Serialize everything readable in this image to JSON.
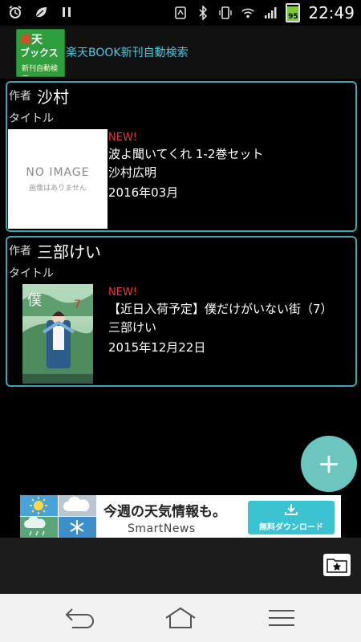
{
  "status_bar": {
    "time": "22:49",
    "battery": "95",
    "left_icons": [
      "alarm-icon",
      "leaf-icon",
      "pause-icon"
    ],
    "right_icons": [
      "nfc-icon",
      "bluetooth-icon",
      "vibrate-icon",
      "wifi-icon",
      "signal-icon",
      "battery-icon"
    ]
  },
  "app_bar": {
    "logo": {
      "line1_mark": "楽",
      "line1": "天",
      "line2": "ブックス",
      "line3": "新刊自動検索"
    },
    "title": "楽天BOOK新刊自動検索"
  },
  "cards": [
    {
      "author_label": "作者",
      "author": "沙村",
      "title_label": "タイトル",
      "cover": {
        "type": "no-image",
        "text": "NO IMAGE",
        "subtext": "画像はありません"
      },
      "badge": "NEW!",
      "book_title": "波よ聞いてくれ 1-2巻セット",
      "book_author": "沙村広明",
      "date": "2016年03月"
    },
    {
      "author_label": "作者",
      "author": "三部けい",
      "title_label": "タイトル",
      "cover": {
        "type": "image"
      },
      "badge": "NEW!",
      "book_title": "【近日入荷予定】僕だけがいない街（7）",
      "book_author": "三部けい",
      "date": "2015年12月22日"
    }
  ],
  "fab": {
    "label": "+"
  },
  "ad": {
    "headline": "今週の天気情報も。",
    "brand": "SmartNews",
    "button": "無料ダウンロード"
  },
  "colors": {
    "accent": "#3aa7b8",
    "title_text": "#4ec9e0",
    "new_badge": "#e23b3b",
    "fab": "#6cc6bf",
    "logo_bg": "#2f9e3c"
  }
}
